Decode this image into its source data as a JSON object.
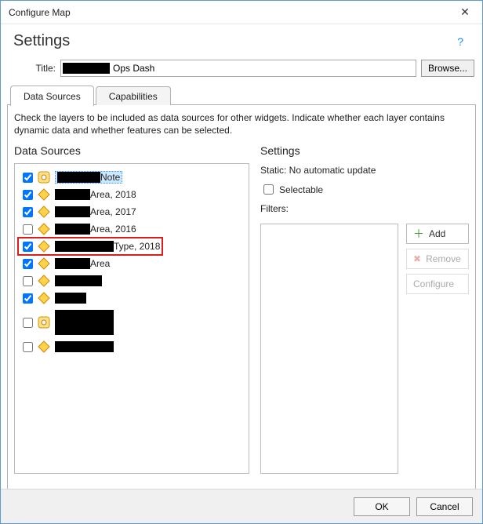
{
  "window": {
    "title": "Configure Map"
  },
  "header": {
    "heading": "Settings"
  },
  "titleField": {
    "label": "Title:",
    "value": "Ops Dash",
    "browse": "Browse..."
  },
  "tabs": {
    "data_sources": "Data Sources",
    "capabilities": "Capabilities"
  },
  "panel": {
    "description": "Check the layers to be included as data sources for other widgets. Indicate whether each layer contains dynamic data and whether features can be selected.",
    "left_heading": "Data Sources",
    "right_heading": "Settings"
  },
  "layers": [
    {
      "checked": true,
      "icon": "point",
      "redact_w": 55,
      "suffix": "Note",
      "selected": true
    },
    {
      "checked": true,
      "icon": "poly",
      "redact_w": 45,
      "suffix": "Area, 2018",
      "selected": false
    },
    {
      "checked": true,
      "icon": "poly",
      "redact_w": 45,
      "suffix": "Area, 2017",
      "selected": false
    },
    {
      "checked": false,
      "icon": "poly",
      "redact_w": 45,
      "suffix": "Area, 2016",
      "selected": false
    },
    {
      "checked": true,
      "icon": "poly",
      "redact_w": 75,
      "suffix": "Type, 2018",
      "selected": false,
      "highlight": true
    },
    {
      "checked": true,
      "icon": "poly",
      "redact_w": 45,
      "suffix": "Area",
      "selected": false
    },
    {
      "checked": false,
      "icon": "poly",
      "redact_w": 60,
      "suffix": "",
      "selected": false
    },
    {
      "checked": true,
      "icon": "poly",
      "redact_w": 40,
      "suffix": "",
      "selected": false
    },
    {
      "checked": false,
      "icon": "point",
      "redact_w": 75,
      "suffix": "",
      "selected": false,
      "tall": true
    },
    {
      "checked": false,
      "icon": "poly",
      "redact_w": 75,
      "suffix": "",
      "selected": false
    }
  ],
  "rightPanel": {
    "static_line": "Static: No automatic update",
    "selectable_label": "Selectable",
    "selectable_checked": false,
    "filters_label": "Filters:",
    "buttons": {
      "add": "Add",
      "remove": "Remove",
      "configure": "Configure"
    }
  },
  "footer": {
    "ok": "OK",
    "cancel": "Cancel"
  }
}
